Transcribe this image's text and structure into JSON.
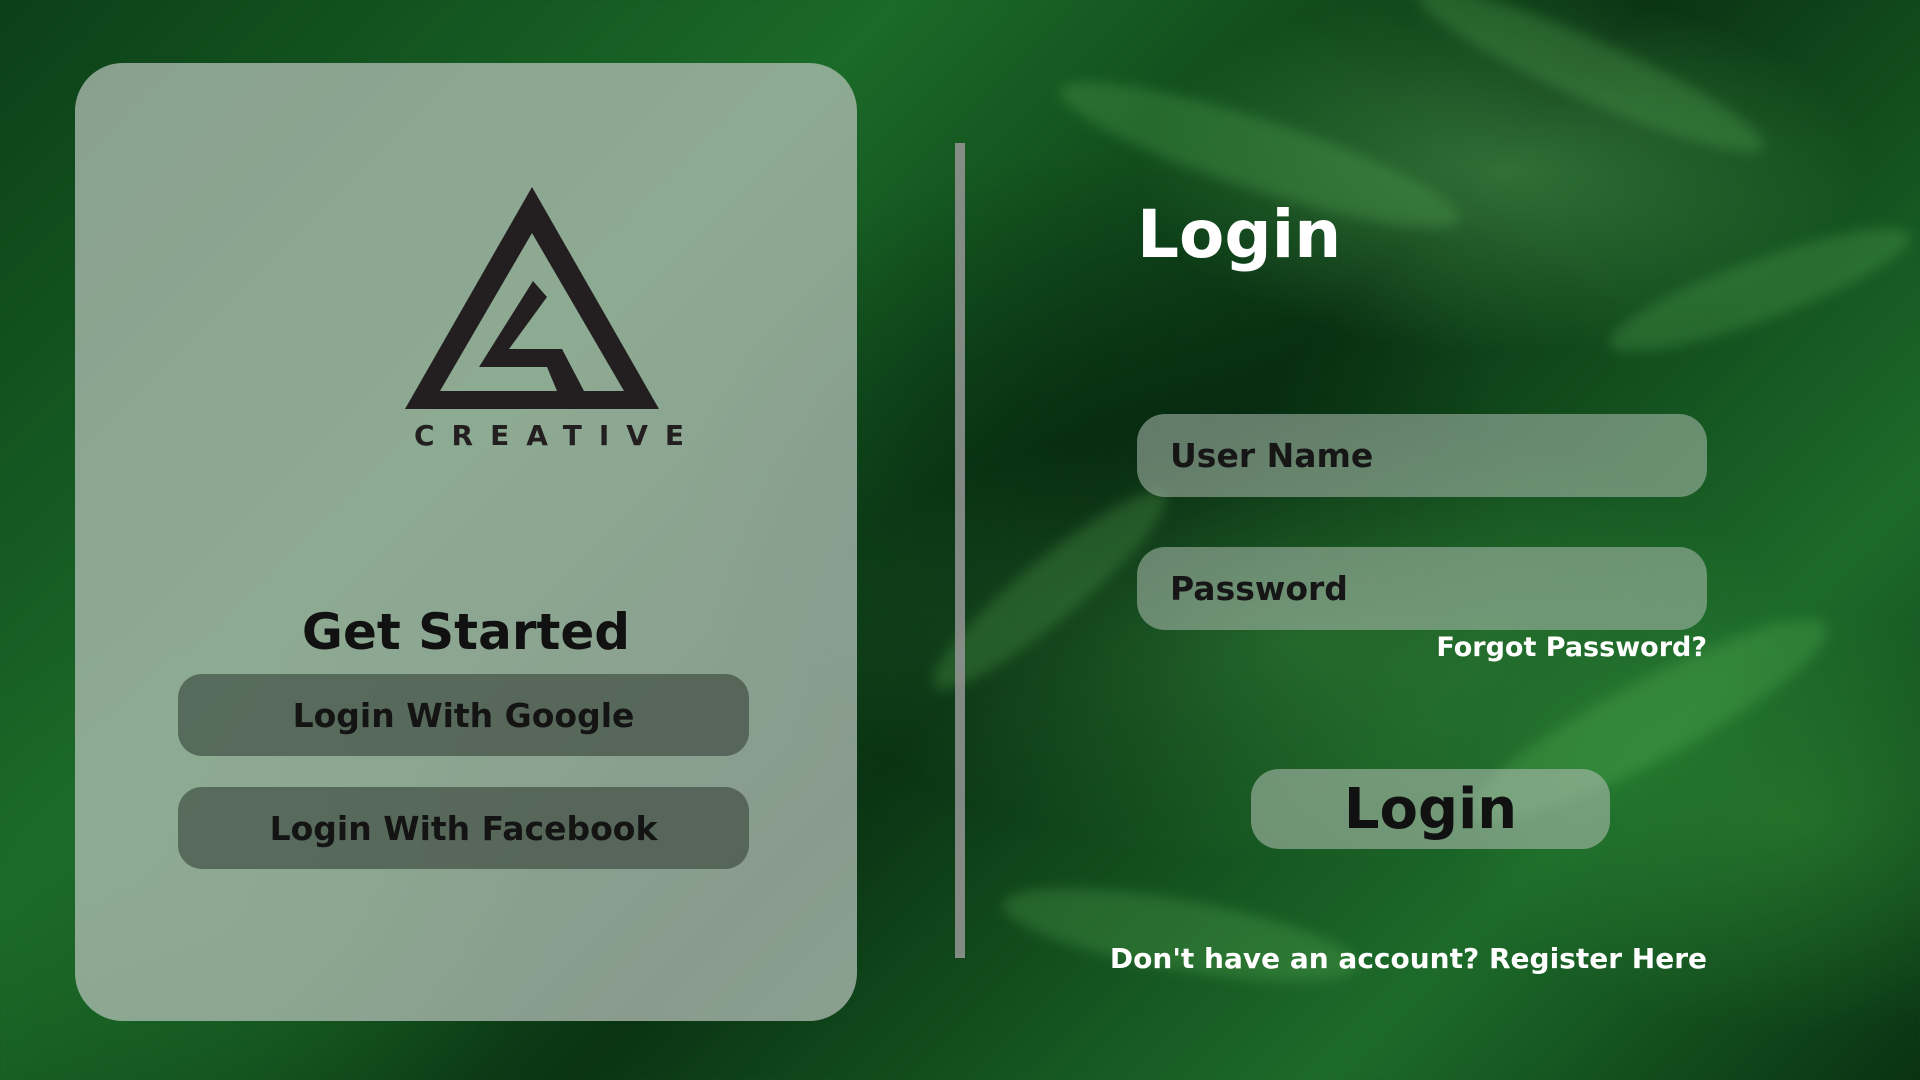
{
  "brand": {
    "logo_text": "CREATIVE"
  },
  "left_panel": {
    "heading": "Get Started",
    "google_button": "Login With Google",
    "facebook_button": "Login With Facebook"
  },
  "login_form": {
    "title": "Login",
    "username_placeholder": "User Name",
    "password_placeholder": "Password",
    "forgot_password": "Forgot Password?",
    "submit_label": "Login",
    "register_prompt": "Don't have an account? Register Here"
  },
  "colors": {
    "background": "#1b6a28",
    "card": "#bac4bc",
    "logo": "#231f20"
  }
}
